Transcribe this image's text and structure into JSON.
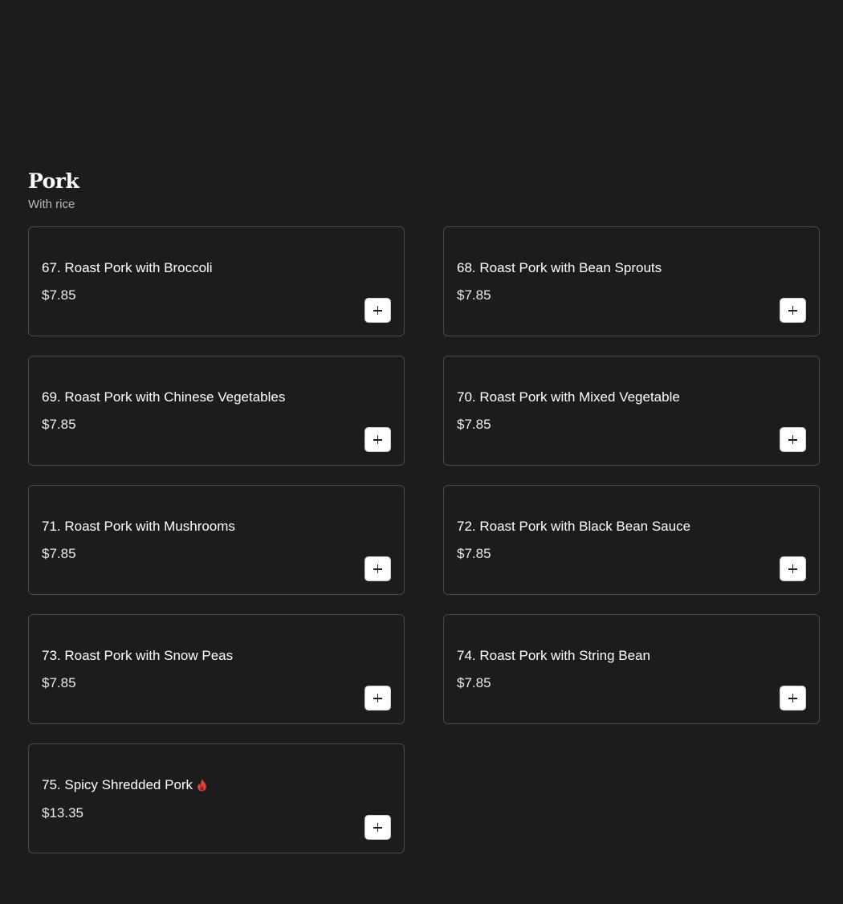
{
  "section": {
    "title": "Pork",
    "subtitle": "With rice"
  },
  "colors": {
    "background": "#1c1c1c",
    "card_border": "#4a4a4a",
    "spicy": "#e0433b",
    "button_bg": "#ffffff"
  },
  "items": [
    {
      "name": "67. Roast Pork with Broccoli",
      "price": "$7.85",
      "spicy": false,
      "add_icon": "plus-icon"
    },
    {
      "name": "68. Roast Pork with Bean Sprouts",
      "price": "$7.85",
      "spicy": false,
      "add_icon": "plus-icon"
    },
    {
      "name": "69. Roast Pork with Chinese Vegetables",
      "price": "$7.85",
      "spicy": false,
      "add_icon": "plus-icon"
    },
    {
      "name": "70. Roast Pork with Mixed Vegetable",
      "price": "$7.85",
      "spicy": false,
      "add_icon": "plus-icon"
    },
    {
      "name": "71. Roast Pork with Mushrooms",
      "price": "$7.85",
      "spicy": false,
      "add_icon": "plus-icon"
    },
    {
      "name": "72. Roast Pork with Black Bean Sauce",
      "price": "$7.85",
      "spicy": false,
      "add_icon": "plus-icon"
    },
    {
      "name": "73. Roast Pork with Snow Peas",
      "price": "$7.85",
      "spicy": false,
      "add_icon": "plus-icon"
    },
    {
      "name": "74. Roast Pork with String Bean",
      "price": "$7.85",
      "spicy": false,
      "add_icon": "plus-icon"
    },
    {
      "name": "75. Spicy Shredded Pork",
      "price": "$13.35",
      "spicy": true,
      "spicy_icon": "chili-flame-icon",
      "add_icon": "plus-icon"
    }
  ]
}
